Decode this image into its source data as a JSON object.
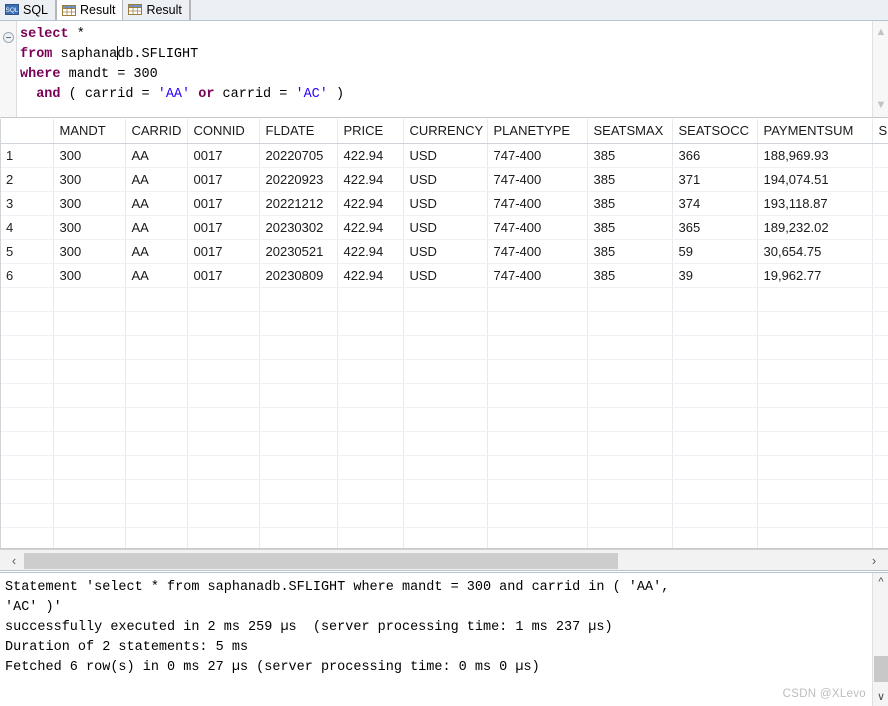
{
  "tabs": [
    {
      "label": "SQL",
      "icon": "sql-icon",
      "active": false
    },
    {
      "label": "Result",
      "icon": "table-grid-icon",
      "active": true
    },
    {
      "label": "Result",
      "icon": "table-grid-icon",
      "active": false
    }
  ],
  "editor": {
    "fold_marker": "collapse-marker",
    "lines": [
      "select *",
      "from saphanadb.SFLIGHT",
      "where mandt = 300",
      "  and ( carrid = 'AA' or carrid = 'AC' )"
    ],
    "keywords": [
      "select",
      "from",
      "where",
      "and",
      "or"
    ],
    "strings": [
      "'AA'",
      "'AC'"
    ],
    "caret_after": "saphana",
    "scroll_up_glyph": "▲",
    "scroll_down_glyph": "▼"
  },
  "grid": {
    "row_number_header": "",
    "columns": [
      "MANDT",
      "CARRID",
      "CONNID",
      "FLDATE",
      "PRICE",
      "CURRENCY",
      "PLANETYPE",
      "SEATSMAX",
      "SEATSOCC",
      "PAYMENTSUM",
      "SEA"
    ],
    "rows": [
      {
        "n": "1",
        "MANDT": "300",
        "CARRID": "AA",
        "CONNID": "0017",
        "FLDATE": "20220705",
        "PRICE": "422.94",
        "CURRENCY": "USD",
        "PLANETYPE": "747-400",
        "SEATSMAX": "385",
        "SEATSOCC": "366",
        "PAYMENTSUM": "188,969.93",
        "SEA": ""
      },
      {
        "n": "2",
        "MANDT": "300",
        "CARRID": "AA",
        "CONNID": "0017",
        "FLDATE": "20220923",
        "PRICE": "422.94",
        "CURRENCY": "USD",
        "PLANETYPE": "747-400",
        "SEATSMAX": "385",
        "SEATSOCC": "371",
        "PAYMENTSUM": "194,074.51",
        "SEA": ""
      },
      {
        "n": "3",
        "MANDT": "300",
        "CARRID": "AA",
        "CONNID": "0017",
        "FLDATE": "20221212",
        "PRICE": "422.94",
        "CURRENCY": "USD",
        "PLANETYPE": "747-400",
        "SEATSMAX": "385",
        "SEATSOCC": "374",
        "PAYMENTSUM": "193,118.87",
        "SEA": ""
      },
      {
        "n": "4",
        "MANDT": "300",
        "CARRID": "AA",
        "CONNID": "0017",
        "FLDATE": "20230302",
        "PRICE": "422.94",
        "CURRENCY": "USD",
        "PLANETYPE": "747-400",
        "SEATSMAX": "385",
        "SEATSOCC": "365",
        "PAYMENTSUM": "189,232.02",
        "SEA": ""
      },
      {
        "n": "5",
        "MANDT": "300",
        "CARRID": "AA",
        "CONNID": "0017",
        "FLDATE": "20230521",
        "PRICE": "422.94",
        "CURRENCY": "USD",
        "PLANETYPE": "747-400",
        "SEATSMAX": "385",
        "SEATSOCC": "59",
        "PAYMENTSUM": "30,654.75",
        "SEA": ""
      },
      {
        "n": "6",
        "MANDT": "300",
        "CARRID": "AA",
        "CONNID": "0017",
        "FLDATE": "20230809",
        "PRICE": "422.94",
        "CURRENCY": "USD",
        "PLANETYPE": "747-400",
        "SEATSMAX": "385",
        "SEATSOCC": "39",
        "PAYMENTSUM": "19,962.77",
        "SEA": ""
      }
    ],
    "empty_row_count": 11
  },
  "hscroll": {
    "left_arrow": "‹",
    "right_arrow": "›"
  },
  "output": {
    "lines": [
      "Statement 'select * from saphanadb.SFLIGHT where mandt = 300 and carrid in ( 'AA', 'AC' )'",
      "successfully executed in 2 ms 259 µs  (server processing time: 1 ms 237 µs)",
      "Duration of 2 statements: 5 ms",
      "Fetched 6 row(s) in 0 ms 27 µs (server processing time: 0 ms 0 µs)"
    ],
    "text": "Statement 'select * from saphanadb.SFLIGHT where mandt = 300 and carrid in ( 'AA',\n'AC' )'\nsuccessfully executed in 2 ms 259 µs  (server processing time: 1 ms 237 µs)\nDuration of 2 statements: 5 ms\nFetched 6 row(s) in 0 ms 27 µs (server processing time: 0 ms 0 µs)",
    "scroll_up_glyph": "^",
    "scroll_down_glyph": "∨"
  },
  "watermark": "CSDN @XLevo",
  "colors": {
    "keyword": "#7a0055",
    "string": "#2a00ff",
    "tab_active_bg": "#ffffff",
    "tab_inactive_bg": "#eceff3",
    "grid_line": "#e7eaee",
    "scroll_thumb": "#cdcdcd"
  }
}
